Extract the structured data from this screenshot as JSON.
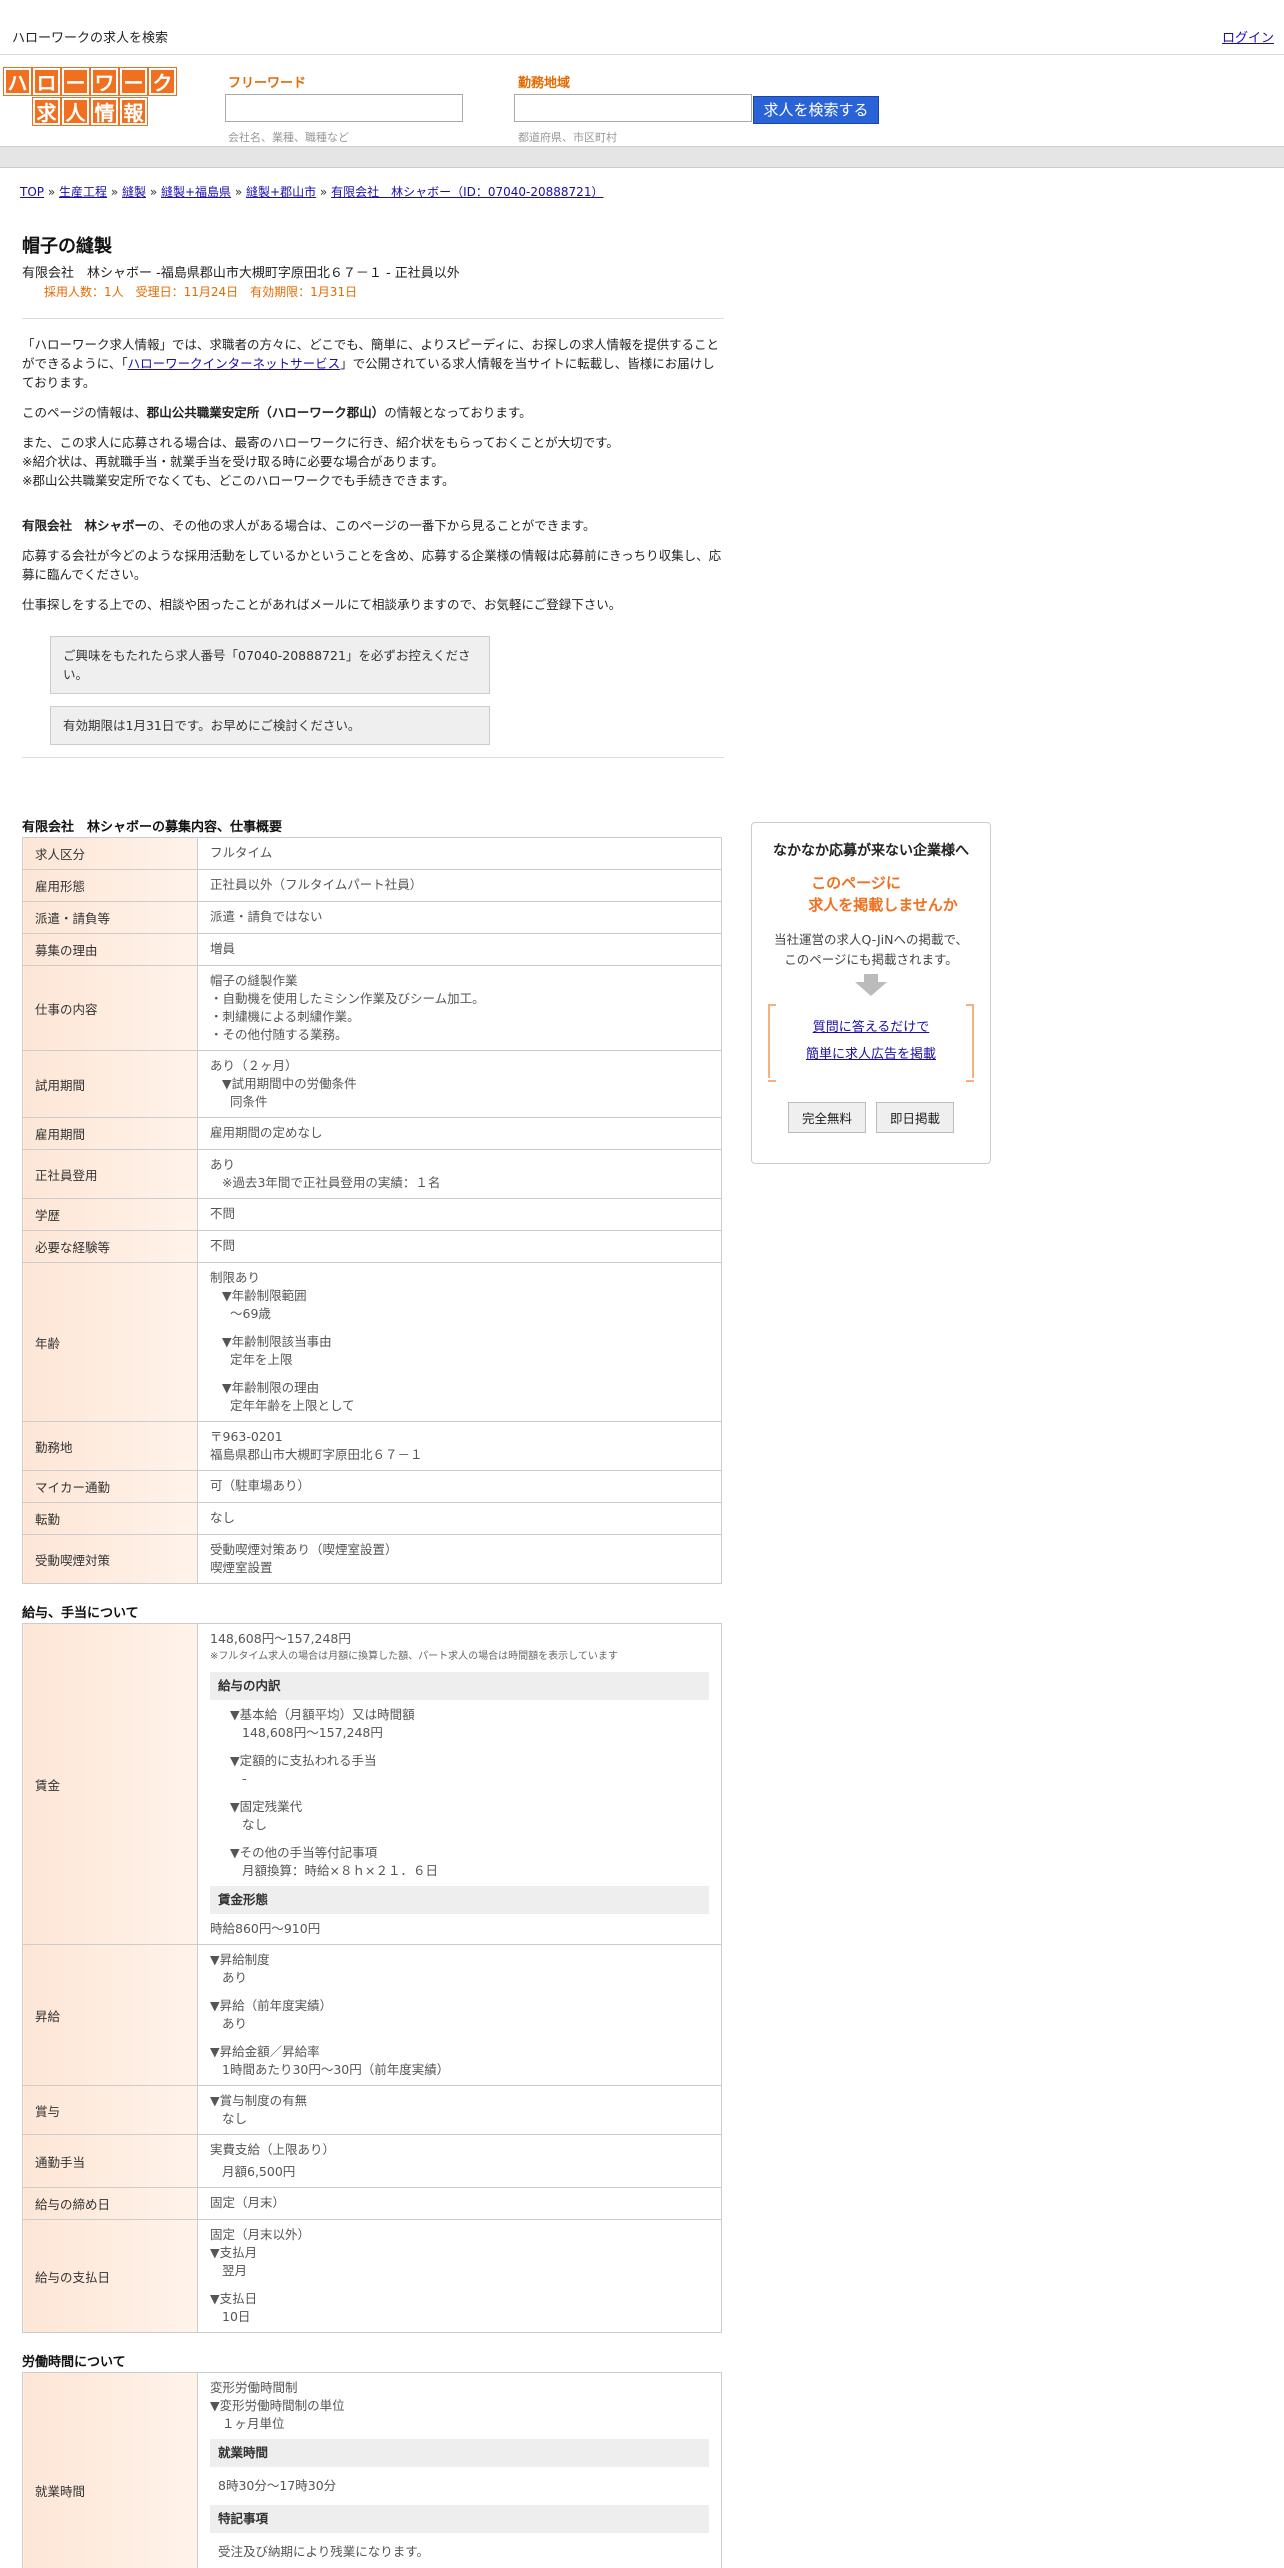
{
  "topbar": {
    "tagline": "ハローワークの求人を検索",
    "login": "ログイン"
  },
  "logo": {
    "row1": [
      "ハ",
      "ロ",
      "ー",
      "ワ",
      "ー",
      "ク"
    ],
    "row2": [
      "求",
      "人",
      "情",
      "報"
    ]
  },
  "search": {
    "freeword_label": "フリーワード",
    "freeword_hint": "会社名、業種、職種など",
    "area_label": "勤務地域",
    "area_hint": "都道府県、市区町村",
    "button": "求人を検索する"
  },
  "breadcrumb": [
    "TOP",
    "生産工程",
    "縫製",
    "縫製+福島県",
    "縫製+郡山市",
    "有限会社　林シャボー（ID：07040-20888721）"
  ],
  "job": {
    "title": "帽子の縫製",
    "subtitle": "有限会社　林シャボー -福島県郡山市大槻町字原田北６７－１ - 正社員以外",
    "meta": "採用人数：1人　受理日：11月24日　有効期限：1月31日"
  },
  "intro": {
    "p1_a": "「ハローワーク求人情報」では、求職者の方々に、どこでも、簡単に、よりスピーディに、お探しの求人情報を提供することができるように、「",
    "p1_link": "ハローワークインターネットサービス",
    "p1_b": "」で公開されている求人情報を当サイトに転載し、皆様にお届けしております。",
    "p2_a": "このページの情報は、",
    "p2_bold": "郡山公共職業安定所（ハローワーク郡山）",
    "p2_b": "の情報となっております。",
    "p3_1": "また、この求人に応募される場合は、最寄のハローワークに行き、紹介状をもらっておくことが大切です。",
    "p3_2": "※紹介状は、再就職手当・就業手当を受け取る時に必要な場合があります。",
    "p3_3": "※郡山公共職業安定所でなくても、どこのハローワークでも手続きできます。",
    "p4_bold": "有限会社　林シャボー",
    "p4_b": "の、その他の求人がある場合は、このページの一番下から見ることができます。",
    "p5": "応募する会社が今どのような採用活動をしているかということを含め、応募する企業様の情報は応募前にきっちり収集し、応募に臨んでください。",
    "p6": "仕事探しをする上での、相談や困ったことがあればメールにて相談承りますので、お気軽にご登録下さい。",
    "notice1": "ご興味をもたれたら求人番号「07040-20888721」を必ずお控えください。",
    "notice2": "有効期限は1月31日です。お早めにご検討ください。"
  },
  "section1": {
    "title": "有限会社　林シャボーの募集内容、仕事概要",
    "rows": {
      "kubun": [
        "求人区分",
        "フルタイム"
      ],
      "keitai": [
        "雇用形態",
        "正社員以外（フルタイムパート社員）"
      ],
      "haken": [
        "派遣・請負等",
        "派遣・請負ではない"
      ],
      "riyu": [
        "募集の理由",
        "増員"
      ],
      "naiyo_h": "仕事の内容",
      "naiyo": [
        "帽子の縫製作業",
        "・自動機を使用したミシン作業及びシーム加工。",
        "・刺繍機による刺繍作業。",
        "・その他付随する業務。"
      ],
      "shiyo_h": "試用期間",
      "shiyo": [
        "あり（２ヶ月）",
        "▼試用期間中の労働条件",
        "同条件"
      ],
      "kikan": [
        "雇用期間",
        "雇用期間の定めなし"
      ],
      "seishain_h": "正社員登用",
      "seishain": [
        "あり",
        "※過去3年間で正社員登用の実績：１名"
      ],
      "gakureki": [
        "学歴",
        "不問"
      ],
      "keiken": [
        "必要な経験等",
        "不問"
      ],
      "nenrei_h": "年齢",
      "nenrei": [
        "制限あり",
        "▼年齢制限範囲",
        "〜69歳",
        "▼年齢制限該当事由",
        "定年を上限",
        "▼年齢制限の理由",
        "定年年齢を上限として"
      ],
      "kinmuchi_h": "勤務地",
      "kinmuchi": [
        "〒963-0201",
        "福島県郡山市大槻町字原田北６７－１"
      ],
      "mycar": [
        "マイカー通勤",
        "可（駐車場あり）"
      ],
      "tenkin": [
        "転勤",
        "なし"
      ],
      "kitsuen_h": "受動喫煙対策",
      "kitsuen": [
        "受動喫煙対策あり（喫煙室設置）",
        "喫煙室設置"
      ]
    }
  },
  "section2": {
    "title": "給与、手当について",
    "chingin_h": "賃金",
    "chingin": {
      "range": "148,608円〜157,248円",
      "note": "※フルタイム求人の場合は月額に換算した額、パート求人の場合は時間額を表示しています",
      "box1": "給与の内訳",
      "k1": "▼基本給（月額平均）又は時間額",
      "v1": "148,608円〜157,248円",
      "k2": "▼定額的に支払われる手当",
      "v2": "-",
      "k3": "▼固定残業代",
      "v3": "なし",
      "k4": "▼その他の手当等付記事項",
      "v4": "月額換算：時給×８ｈ×２１．６日",
      "box2": "賃金形態",
      "v5": "時給860円〜910円"
    },
    "shokyu_h": "昇給",
    "shokyu": [
      "▼昇給制度",
      "あり",
      "▼昇給（前年度実績）",
      "あり",
      "▼昇給金額／昇給率",
      "1時間あたり30円〜30円（前年度実績）"
    ],
    "shoyo_h": "賞与",
    "shoyo": [
      "▼賞与制度の有無",
      "なし"
    ],
    "tsukin_h": "通勤手当",
    "tsukin": [
      "実費支給（上限あり）",
      "月額6,500円"
    ],
    "shime": [
      "給与の締め日",
      "固定（月末）"
    ],
    "shiharai_h": "給与の支払日",
    "shiharai": [
      "固定（月末以外）",
      "▼支払月",
      "翌月",
      "▼支払日",
      "10日"
    ]
  },
  "section3": {
    "title": "労働時間について",
    "shugyo_h": "就業時間",
    "l1": "変形労働時間制",
    "l2": "▼変形労働時間制の単位",
    "l3": "１ヶ月単位",
    "box1": "就業時間",
    "l4": "8時30分〜17時30分",
    "box2": "特記事項",
    "l5": "受注及び納期により残業になります。"
  },
  "side": {
    "title": "なかなか応募が来ない企業様へ",
    "orange1": "このページに",
    "orange2": "求人を掲載しませんか",
    "text1": "当社運営の求人Q-JiNへの掲載で、",
    "text2": "このページにも掲載されます。",
    "link1": "質問に答えるだけで",
    "link2": "簡単に求人広告を掲載",
    "btn1": "完全無料",
    "btn2": "即日掲載"
  }
}
